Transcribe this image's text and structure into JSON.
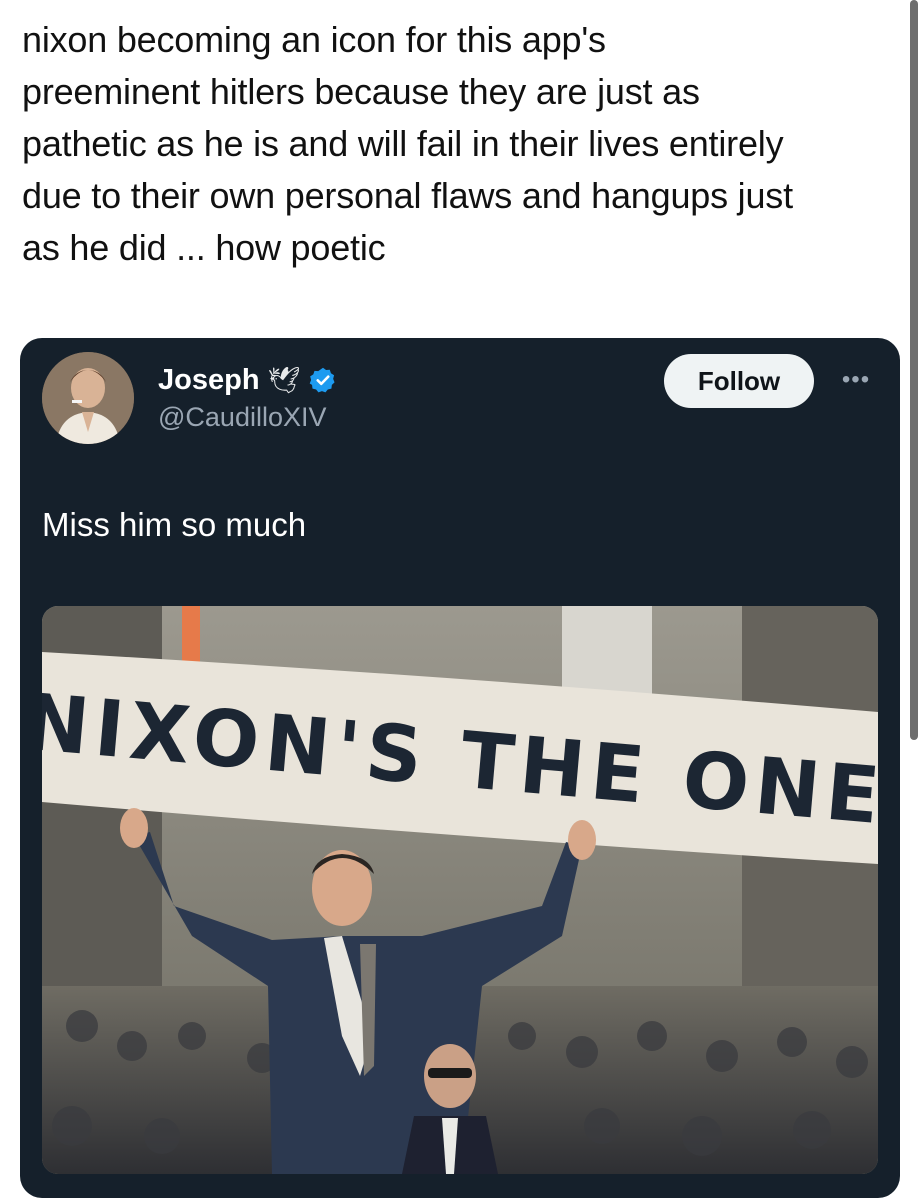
{
  "post": {
    "lines": [
      "nixon becoming an icon for this app's",
      "preeminent hitlers because they are just as",
      "pathetic as he is and will fail in their lives entirely",
      "due to their own personal flaws and hangups just",
      "as he did ... how poetic"
    ]
  },
  "quoted_tweet": {
    "display_name": "Joseph",
    "name_emoji": "🕊",
    "handle": "@CaudilloXIV",
    "follow_label": "Follow",
    "more_label": "•••",
    "body": "Miss him so much",
    "image": {
      "banner_text": "NIXON'S THE ONE"
    }
  },
  "colors": {
    "card_bg": "#15202b",
    "verified": "#1d9bf0",
    "follow_bg": "#eff3f4"
  }
}
